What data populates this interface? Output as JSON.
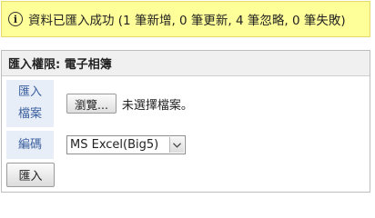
{
  "notice": {
    "icon": "info-icon",
    "text": "資料已匯入成功 (1 筆新增, 0 筆更新, 4 筆忽略, 0 筆失敗)",
    "background_color": "#ffff99"
  },
  "panel": {
    "title": "匯入權限: 電子相簿",
    "file_row": {
      "label_line1": "匯入",
      "label_line2": "檔案",
      "browse_label": "瀏覽...",
      "status_text": "未選擇檔案。"
    },
    "encoding_row": {
      "label": "編碼",
      "selected": "MS Excel(Big5)",
      "arrow_icon": "chevron-down-icon"
    },
    "submit_label": "匯入"
  },
  "colors": {
    "label_background": "#e8eef8",
    "label_text": "#3a5f9e",
    "header_background": "#f0f0f0"
  }
}
